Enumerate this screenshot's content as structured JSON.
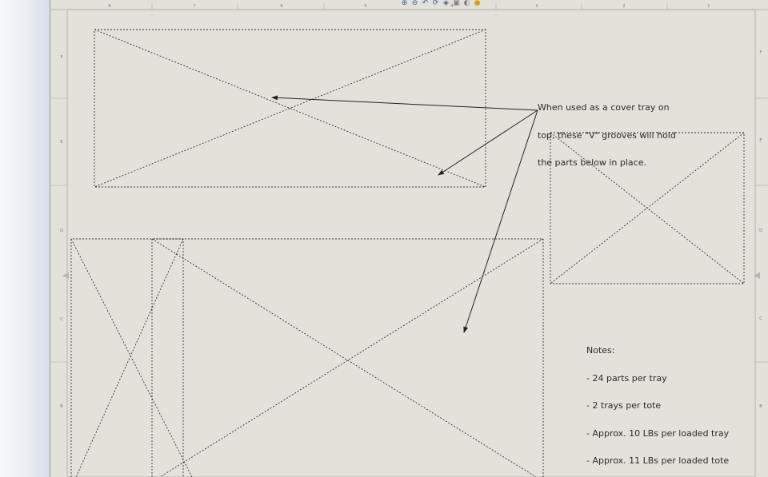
{
  "toolbar": {
    "icons": [
      "zoom-to-fit-icon",
      "zoom-area-icon",
      "previous-view-icon",
      "rotate-view-icon",
      "section-view-icon",
      "display-style-icon",
      "hide-show-icon",
      "appearance-icon"
    ]
  },
  "sheet": {
    "column_markers": [
      "8",
      "7",
      "6",
      "5",
      "4",
      "3",
      "2",
      "1"
    ],
    "row_markers": [
      "F",
      "E",
      "D",
      "C",
      "B"
    ]
  },
  "annotation": {
    "lines": [
      "When used as a cover tray on",
      "top, these \"V\" grooves will hold",
      "the parts below in place."
    ]
  },
  "notes": {
    "title": "Notes:",
    "items": [
      "- 24 parts per tray",
      "- 2 trays per tote",
      "- Approx. 10 LBs per loaded tray",
      "- Approx. 11 LBs per loaded tote"
    ]
  }
}
